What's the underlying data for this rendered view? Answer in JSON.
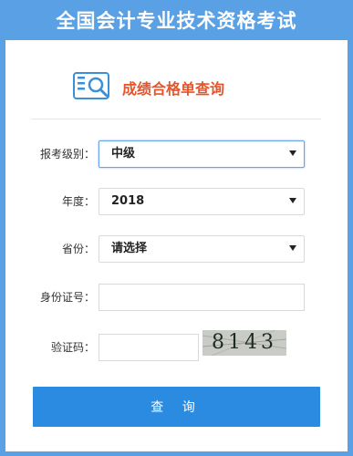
{
  "header": {
    "title": "全国会计专业技术资格考试"
  },
  "subheader": {
    "title": "成绩合格单查询",
    "icon": "report-search-icon"
  },
  "form": {
    "level": {
      "label": "报考级别：",
      "value": "中级"
    },
    "year": {
      "label": "年度：",
      "value": "2018"
    },
    "province": {
      "label": "省份：",
      "value": "请选择"
    },
    "id_number": {
      "label": "身份证号：",
      "value": ""
    },
    "captcha": {
      "label": "验证码：",
      "value": "",
      "image_text": "8143"
    }
  },
  "submit": {
    "label": "查 询"
  },
  "colors": {
    "background": "#5aa0e4",
    "accent": "#2a8be0",
    "subtitle": "#e8542a"
  }
}
